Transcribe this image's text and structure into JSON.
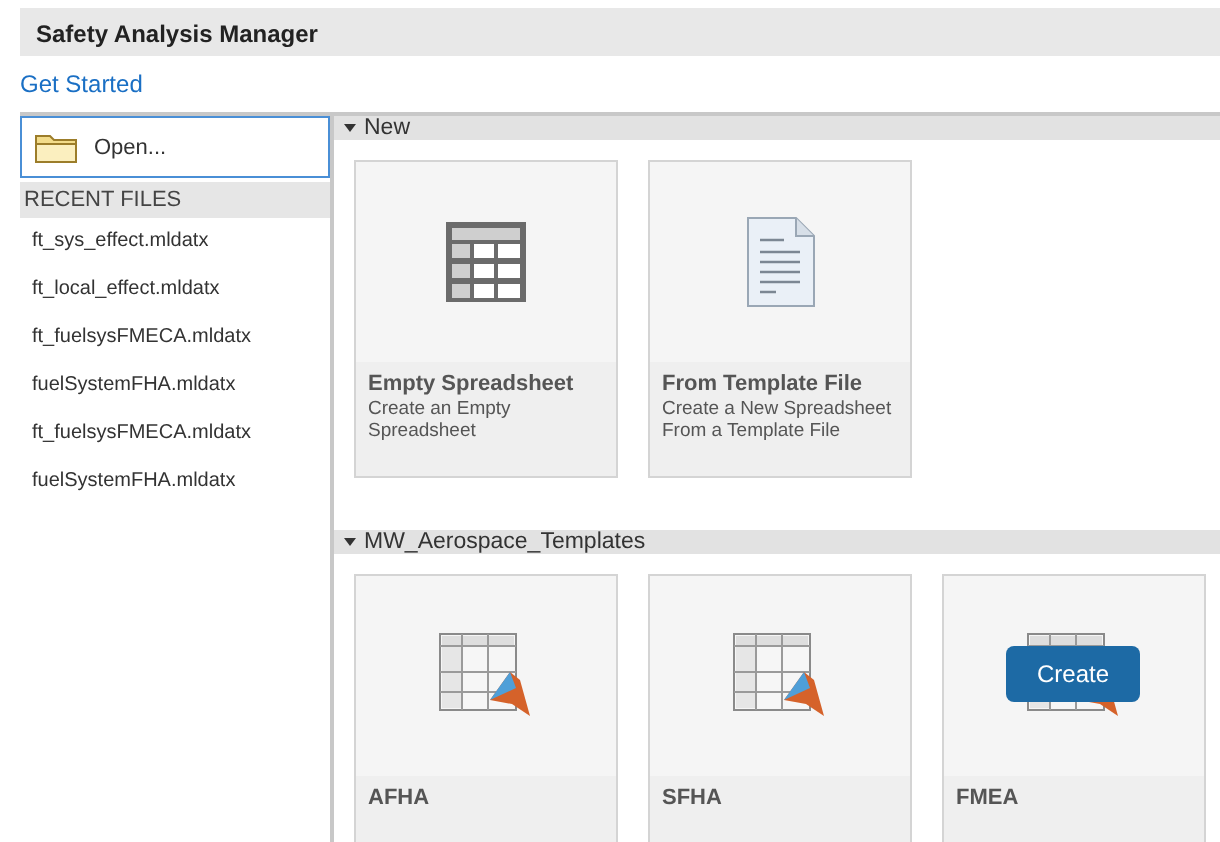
{
  "window": {
    "title": "Safety Analysis Manager"
  },
  "tabs": [
    {
      "label": "Get Started",
      "selected": true
    }
  ],
  "sidebar": {
    "open_button": "Open...",
    "recent_header": "RECENT FILES",
    "recent_files": [
      "ft_sys_effect.mldatx",
      "ft_local_effect.mldatx",
      "ft_fuelsysFMECA.mldatx",
      "fuelSystemFHA.mldatx",
      "ft_fuelsysFMECA.mldatx",
      "fuelSystemFHA.mldatx"
    ]
  },
  "sections": [
    {
      "title": "New",
      "expanded": true,
      "cards": [
        {
          "kind": "spreadsheet",
          "title": "Empty Spreadsheet",
          "description": "Create an Empty Spreadsheet"
        },
        {
          "kind": "document",
          "title": "From Template File",
          "description": "Create a New Spreadsheet From a Template File"
        }
      ]
    },
    {
      "title": "MW_Aerospace_Templates",
      "expanded": true,
      "cards": [
        {
          "kind": "template",
          "title": "AFHA"
        },
        {
          "kind": "template",
          "title": "SFHA"
        },
        {
          "kind": "template",
          "title": "FMEA",
          "hover_action": "Create"
        }
      ]
    }
  ]
}
